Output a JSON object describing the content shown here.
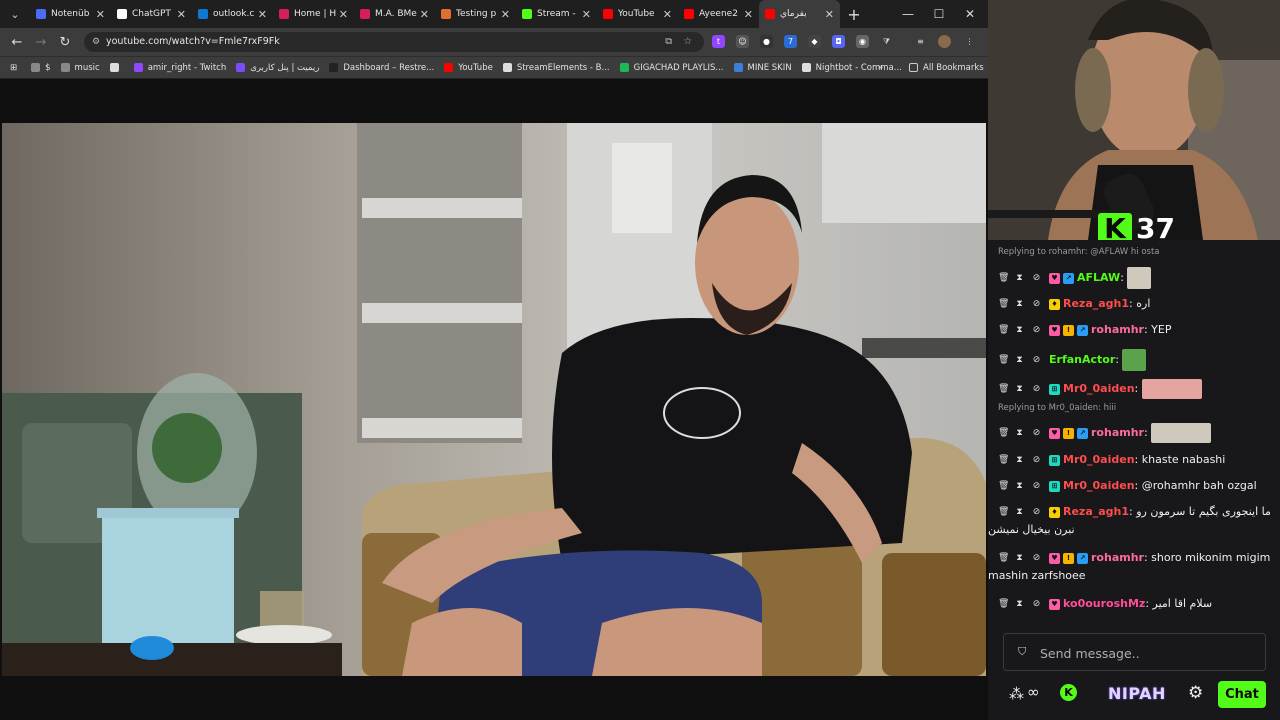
{
  "browser": {
    "tabs": [
      {
        "label": "Notenüb",
        "color": "#4a6cf7"
      },
      {
        "label": "ChatGPT",
        "color": "#ffffff"
      },
      {
        "label": "outlook.c",
        "color": "#0f78d4"
      },
      {
        "label": "Home | H",
        "color": "#d61f5a"
      },
      {
        "label": "M.A. BMe",
        "color": "#d61f5a"
      },
      {
        "label": "Testing p",
        "color": "#e07030"
      },
      {
        "label": "Stream -",
        "color": "#53fc18"
      },
      {
        "label": "YouTube",
        "color": "#ff0000"
      },
      {
        "label": "Ayeene2",
        "color": "#ff0000"
      },
      {
        "label": "بفرماي",
        "color": "#ff0000"
      }
    ],
    "new_tab_label": "+",
    "url": "youtube.com/watch?v=Fmle7rxF9Fk",
    "bookmarks": [
      {
        "label": "$",
        "color": "#888888"
      },
      {
        "label": "music",
        "color": "#888888"
      },
      {
        "label": "",
        "color": "#dddddd"
      },
      {
        "label": "amir_right - Twitch",
        "color": "#9146ff"
      },
      {
        "label": "ریمیت | پنل کاربری",
        "color": "#7a4cff"
      },
      {
        "label": "Dashboard – Restre...",
        "color": "#222222"
      },
      {
        "label": "YouTube",
        "color": "#ff0000"
      },
      {
        "label": "StreamElements - B...",
        "color": "#dddddd"
      },
      {
        "label": "GIGACHAD PLAYLIS...",
        "color": "#1db954"
      },
      {
        "label": "MINE SKIN",
        "color": "#3b7fd6"
      },
      {
        "label": "Nightbot - Comma...",
        "color": "#dddddd"
      }
    ],
    "bookmarks_more": "»",
    "all_bookmarks": "All Bookmarks"
  },
  "stream": {
    "viewer_count": "37",
    "kick_logo": "K"
  },
  "chat": {
    "messages": [
      {
        "reply_to": "Replying to rohamhr: @AFLAW hi osta"
      },
      {
        "user": "AFLAW",
        "color": "#53fc18",
        "text": "",
        "badges": [
          "sub",
          "verified"
        ]
      },
      {
        "user": "Reza_agh1",
        "color": "#ff4d4d",
        "text": "اره",
        "badges": [
          "gift"
        ]
      },
      {
        "user": "rohamhr",
        "color": "#ff6b9d",
        "text": "YEP",
        "badges": [
          "sub",
          "og",
          "verified"
        ]
      },
      {
        "user": "ErfanActor",
        "color": "#53fc18",
        "text": "",
        "badges": []
      },
      {
        "user": "Mr0_0aiden",
        "color": "#ff4d4d",
        "text": "",
        "badges": [
          "vip"
        ]
      },
      {
        "reply_to": "Replying to Mr0_0aiden: hiii"
      },
      {
        "user": "rohamhr",
        "color": "#ff6b9d",
        "text": "",
        "badges": [
          "sub",
          "og",
          "verified"
        ]
      },
      {
        "user": "Mr0_0aiden",
        "color": "#ff4d4d",
        "text": "khaste nabashi",
        "badges": [
          "vip"
        ]
      },
      {
        "user": "Mr0_0aiden",
        "color": "#ff4d4d",
        "text": "@rohamhr bah ozgal",
        "badges": [
          "vip"
        ]
      },
      {
        "user": "Reza_agh1",
        "color": "#ff4d4d",
        "text": "ما اینجوری بگیم تا سرمون رو",
        "text2": "نبرن بیخیال نمیشن",
        "badges": [
          "gift"
        ]
      },
      {
        "user": "rohamhr",
        "color": "#ff6b9d",
        "text": "shoro mikonim migim",
        "text2": "mashin zarfshoee",
        "badges": [
          "sub",
          "og",
          "verified"
        ]
      },
      {
        "user": "ko0ouroshMz",
        "color": "#ff4d9a",
        "text": "سلام اقا امیر",
        "badges": [
          "sub"
        ]
      }
    ],
    "input_placeholder": "Send message..",
    "send_label": "Chat",
    "nipah_label": "NIPAH"
  },
  "colors": {
    "kick_green": "#53fc18",
    "chat_bg": "#18181b"
  }
}
